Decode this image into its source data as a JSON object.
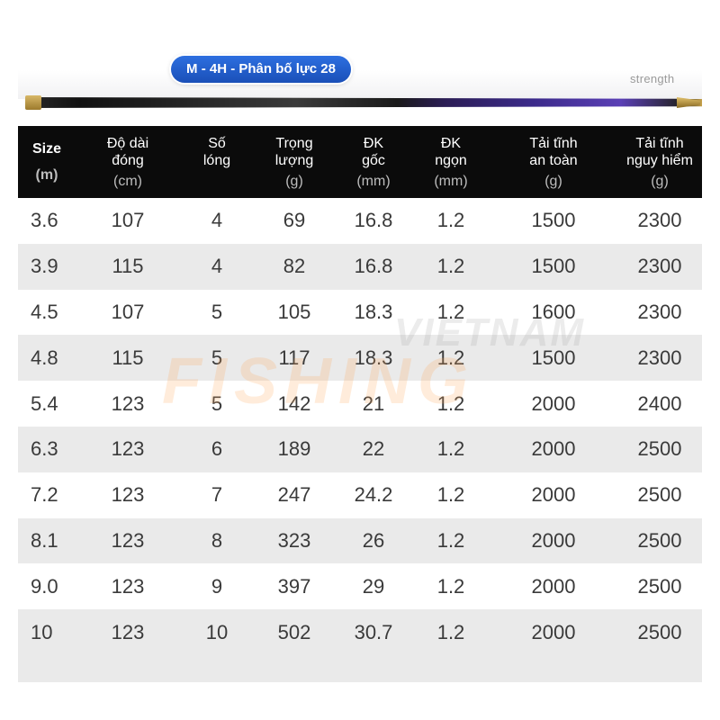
{
  "banner": {
    "model_label": "M - 4H - Phân bố lực 28",
    "strength_label": "strength"
  },
  "table": {
    "headers": [
      {
        "line1": "Size",
        "line2": "",
        "unit": "(m)"
      },
      {
        "line1": "Độ dài",
        "line2": "đóng",
        "unit": "(cm)"
      },
      {
        "line1": "Số",
        "line2": "lóng",
        "unit": ""
      },
      {
        "line1": "Trọng",
        "line2": "lượng",
        "unit": "(g)"
      },
      {
        "line1": "ĐK",
        "line2": "gốc",
        "unit": "(mm)"
      },
      {
        "line1": "ĐK",
        "line2": "ngọn",
        "unit": "(mm)"
      },
      {
        "line1": "Tải tĩnh",
        "line2": "an toàn",
        "unit": "(g)"
      },
      {
        "line1": "Tải tĩnh",
        "line2": "nguy hiểm",
        "unit": "(g)"
      }
    ],
    "rows": [
      [
        "3.6",
        "107",
        "4",
        "69",
        "16.8",
        "1.2",
        "1500",
        "2300"
      ],
      [
        "3.9",
        "115",
        "4",
        "82",
        "16.8",
        "1.2",
        "1500",
        "2300"
      ],
      [
        "4.5",
        "107",
        "5",
        "105",
        "18.3",
        "1.2",
        "1600",
        "2300"
      ],
      [
        "4.8",
        "115",
        "5",
        "117",
        "18.3",
        "1.2",
        "1500",
        "2300"
      ],
      [
        "5.4",
        "123",
        "5",
        "142",
        "21",
        "1.2",
        "2000",
        "2400"
      ],
      [
        "6.3",
        "123",
        "6",
        "189",
        "22",
        "1.2",
        "2000",
        "2500"
      ],
      [
        "7.2",
        "123",
        "7",
        "247",
        "24.2",
        "1.2",
        "2000",
        "2500"
      ],
      [
        "8.1",
        "123",
        "8",
        "323",
        "26",
        "1.2",
        "2000",
        "2500"
      ],
      [
        "9.0",
        "123",
        "9",
        "397",
        "29",
        "1.2",
        "2000",
        "2500"
      ],
      [
        "10",
        "123",
        "10",
        "502",
        "30.7",
        "1.2",
        "2000",
        "2500"
      ]
    ]
  },
  "watermark": {
    "top": "VIETNAM",
    "bottom": "FISHING"
  },
  "colors": {
    "header_bg": "#0b0b0b",
    "row_alt_bg": "#eaeaea",
    "badge_blue": "#1a4fb8",
    "rod_purple": "#5a3fb5"
  }
}
